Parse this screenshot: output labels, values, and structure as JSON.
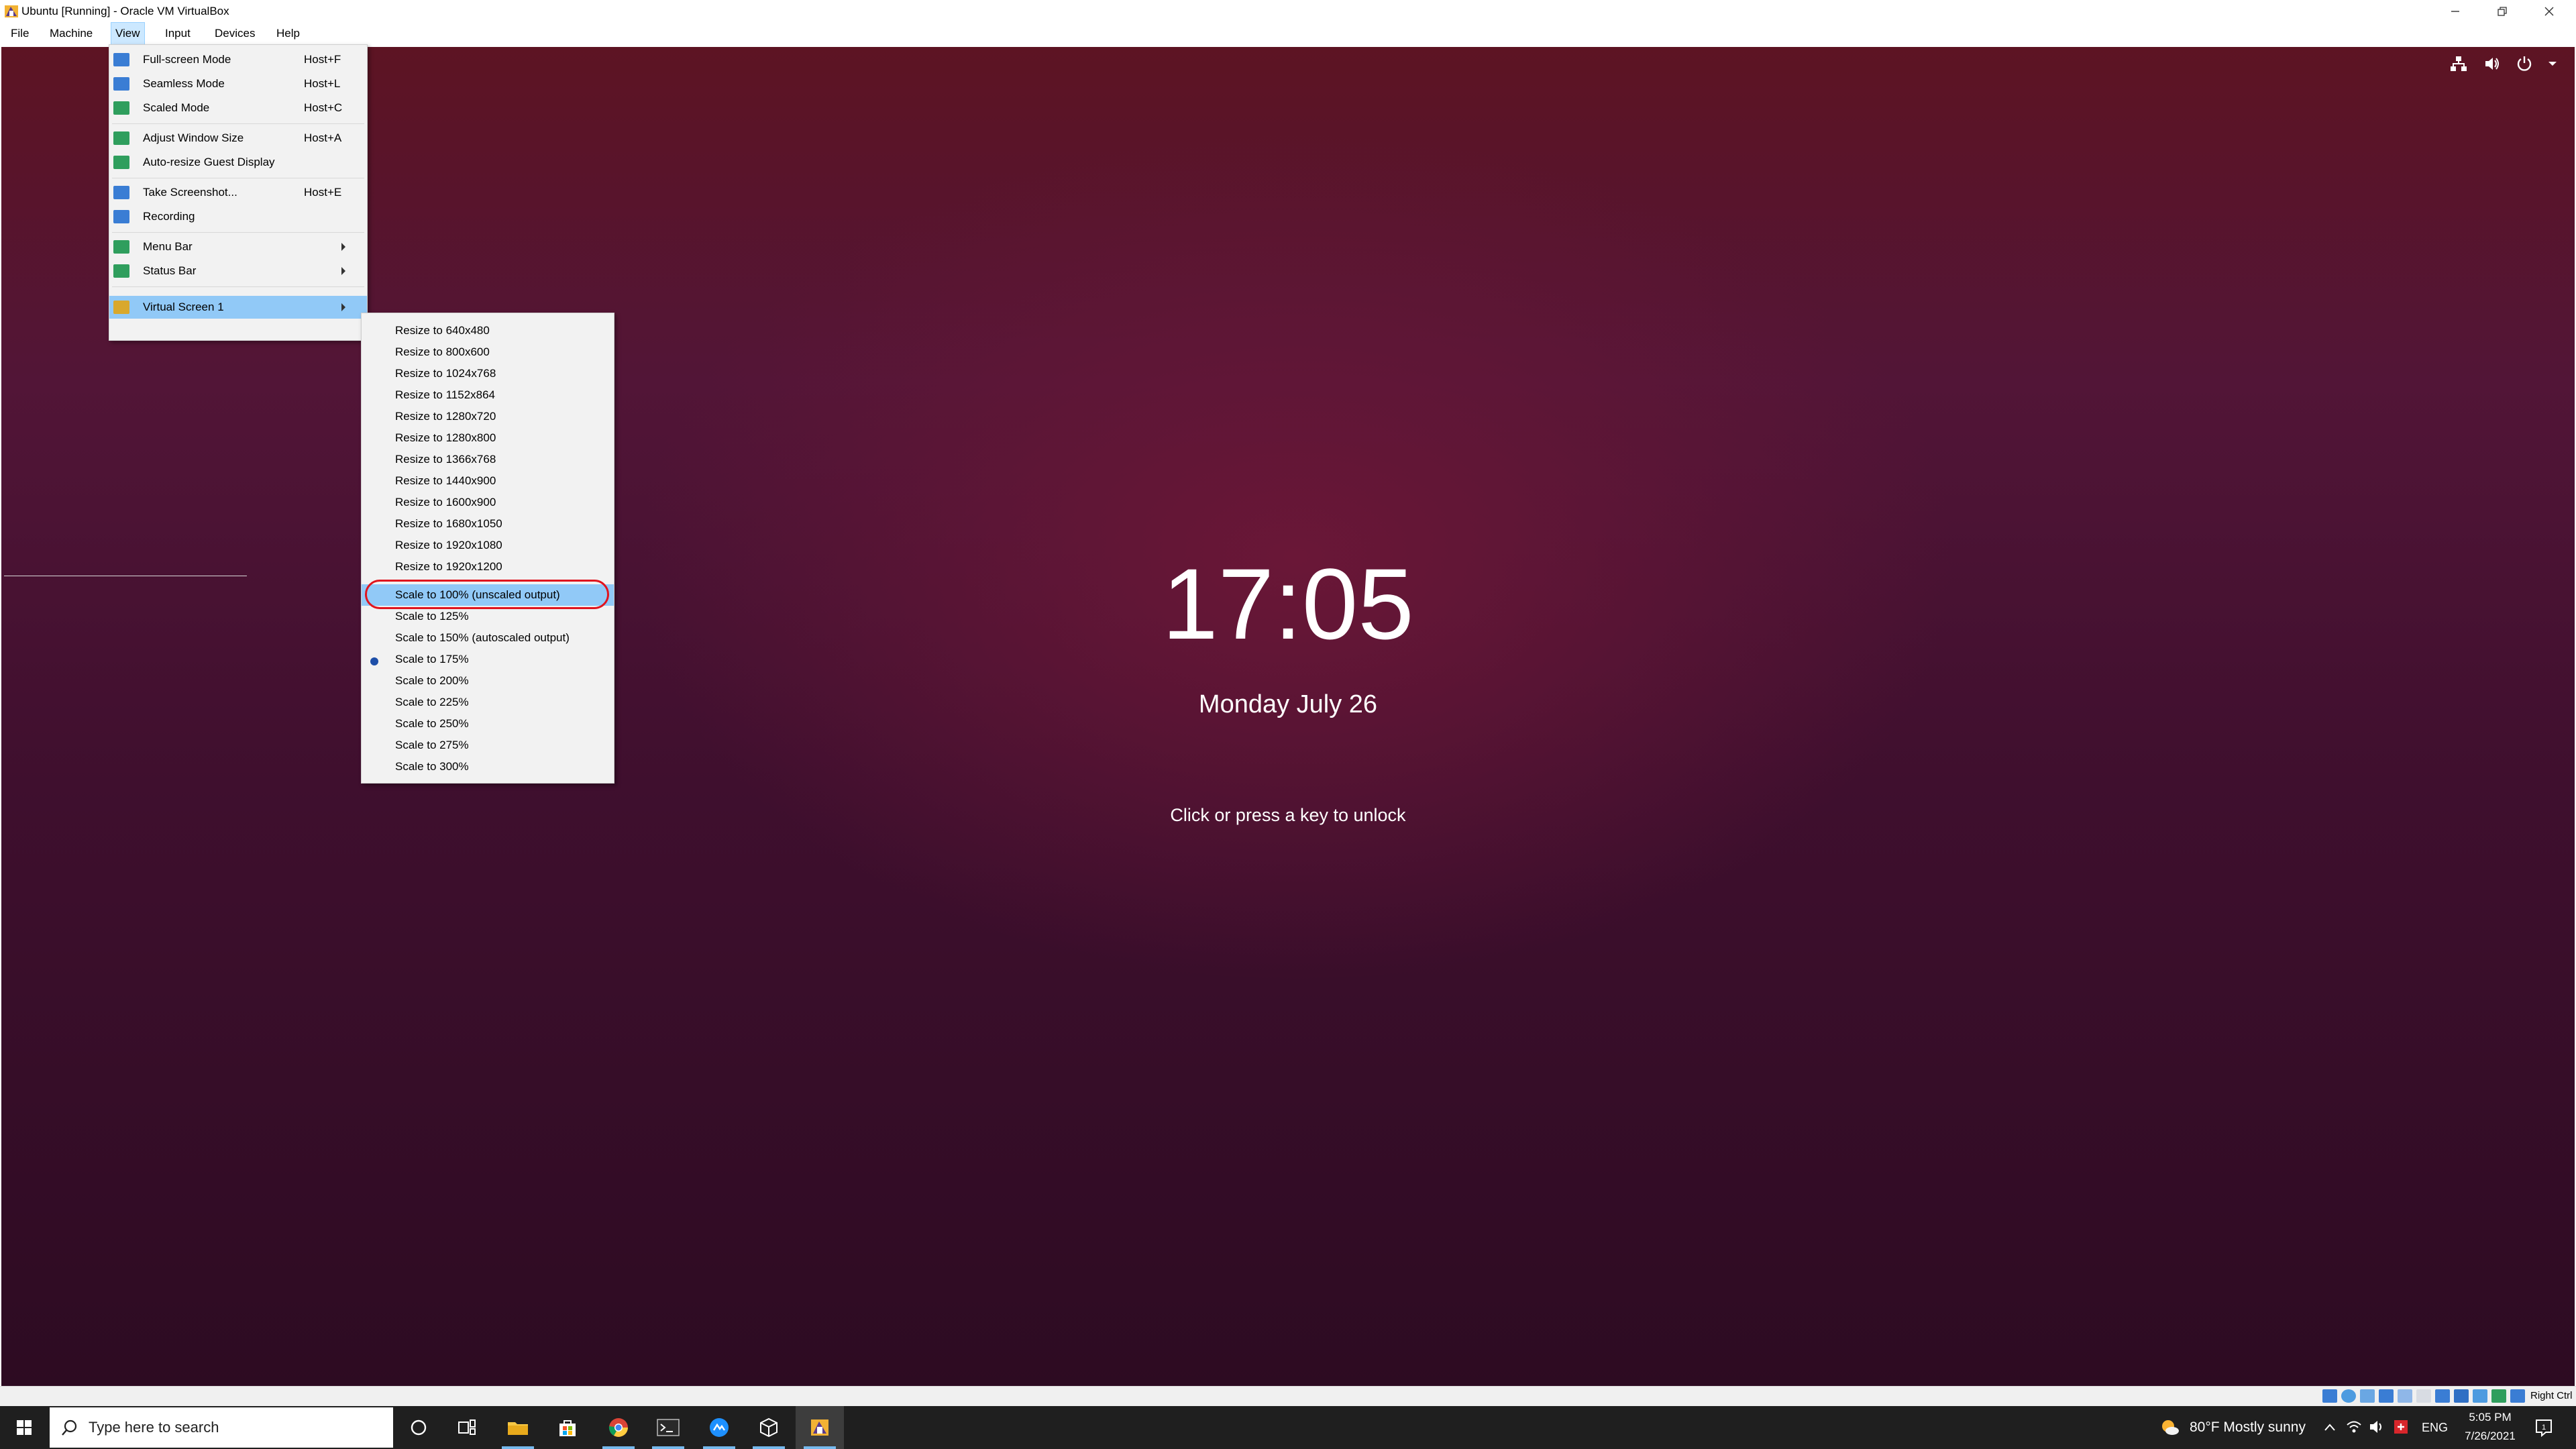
{
  "window": {
    "title": "Ubuntu [Running] - Oracle VM VirtualBox",
    "controls": [
      "minimize",
      "restore",
      "close"
    ]
  },
  "menubar": {
    "items": [
      {
        "label": "File"
      },
      {
        "label": "Machine"
      },
      {
        "label": "View"
      },
      {
        "label": "Input"
      },
      {
        "label": "Devices"
      },
      {
        "label": "Help"
      }
    ],
    "active": "View"
  },
  "view_menu": {
    "items": [
      {
        "label": "Full-screen Mode",
        "shortcut": "Host+F"
      },
      {
        "label": "Seamless Mode",
        "shortcut": "Host+L"
      },
      {
        "label": "Scaled Mode",
        "shortcut": "Host+C"
      },
      {
        "label": "Adjust Window Size",
        "shortcut": "Host+A"
      },
      {
        "label": "Auto-resize Guest Display"
      },
      {
        "label": "Take Screenshot...",
        "shortcut": "Host+E"
      },
      {
        "label": "Recording"
      },
      {
        "label": "Menu Bar"
      },
      {
        "label": "Status Bar"
      },
      {
        "label": "Virtual Screen 1"
      }
    ],
    "highlighted": "Virtual Screen 1"
  },
  "virtual_screen_submenu": {
    "resize_items": [
      {
        "label": "Resize to 640x480"
      },
      {
        "label": "Resize to 800x600"
      },
      {
        "label": "Resize to 1024x768"
      },
      {
        "label": "Resize to 1152x864"
      },
      {
        "label": "Resize to 1280x720"
      },
      {
        "label": "Resize to 1280x800"
      },
      {
        "label": "Resize to 1366x768"
      },
      {
        "label": "Resize to 1440x900"
      },
      {
        "label": "Resize to 1600x900"
      },
      {
        "label": "Resize to 1680x1050"
      },
      {
        "label": "Resize to 1920x1080"
      },
      {
        "label": "Resize to 1920x1200"
      }
    ],
    "scale_items": [
      {
        "label": "Scale to 100% (unscaled output)"
      },
      {
        "label": "Scale to 125%"
      },
      {
        "label": "Scale to 150% (autoscaled output)"
      },
      {
        "label": "Scale to 175%"
      },
      {
        "label": "Scale to 200%"
      },
      {
        "label": "Scale to 225%"
      },
      {
        "label": "Scale to 250%"
      },
      {
        "label": "Scale to 275%"
      },
      {
        "label": "Scale to 300%"
      }
    ],
    "highlighted": "Scale to 100% (unscaled output)",
    "selected": "Scale to 175%"
  },
  "lock_screen": {
    "time": "17:05",
    "date": "Monday July 26",
    "hint": "Click or press a key to unlock",
    "top_bar_icons": [
      "network-icon",
      "volume-icon",
      "power-icon",
      "dropdown-arrow-icon"
    ]
  },
  "statusbar": {
    "host_key": "Right Ctrl"
  },
  "taskbar": {
    "search_placeholder": "Type here to search",
    "apps": [
      "start-icon",
      "cortana-icon",
      "task-view-icon",
      "file-explorer-icon",
      "store-icon",
      "chrome-icon",
      "terminal-icon",
      "maps-icon",
      "package-icon",
      "virtualbox-icon"
    ],
    "weather": "80°F  Mostly sunny",
    "language": "ENG",
    "time": "5:05 PM",
    "date": "7/26/2021"
  },
  "colors": {
    "menu_highlight": "#91c9f7",
    "annotation_red": "#e0141e",
    "wallpaper_top": "#5d1423",
    "wallpaper_bottom": "#2d0b22",
    "taskbar_bg": "#1f1f1f"
  }
}
